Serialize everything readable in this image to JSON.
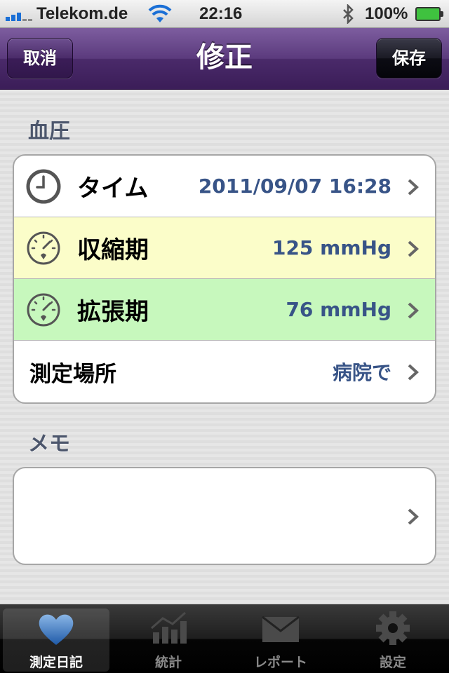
{
  "status_bar": {
    "carrier": "Telekom.de",
    "time": "22:16",
    "battery_percent": "100%",
    "signal_icon": "signal-bars-icon",
    "wifi_icon": "wifi-icon",
    "bluetooth_icon": "bluetooth-icon",
    "battery_icon": "battery-charging-icon"
  },
  "nav": {
    "title": "修正",
    "cancel_label": "取消",
    "save_label": "保存"
  },
  "blood_pressure": {
    "header": "血圧",
    "rows": [
      {
        "label": "タイム",
        "value": "2011/09/07 16:28",
        "icon": "clock-icon",
        "color": "#ffffff"
      },
      {
        "label": "収縮期",
        "value": "125 mmHg",
        "icon": "gauge-icon",
        "color": "#fbfdc9"
      },
      {
        "label": "拡張期",
        "value": "76 mmHg",
        "icon": "gauge-icon",
        "color": "#c7f8bd"
      },
      {
        "label": "測定場所",
        "value": "病院で"
      }
    ]
  },
  "memo": {
    "header": "メモ",
    "value": ""
  },
  "tab_bar": {
    "tabs": [
      {
        "label": "測定日記",
        "icon": "heart-icon",
        "active": true
      },
      {
        "label": "統計",
        "icon": "chart-icon",
        "active": false
      },
      {
        "label": "レポート",
        "icon": "envelope-icon",
        "active": false
      },
      {
        "label": "設定",
        "icon": "gear-icon",
        "active": false
      }
    ]
  },
  "colors": {
    "nav_purple": "#5b3a7d",
    "value_blue": "#385487",
    "section_header": "#4c566c"
  }
}
